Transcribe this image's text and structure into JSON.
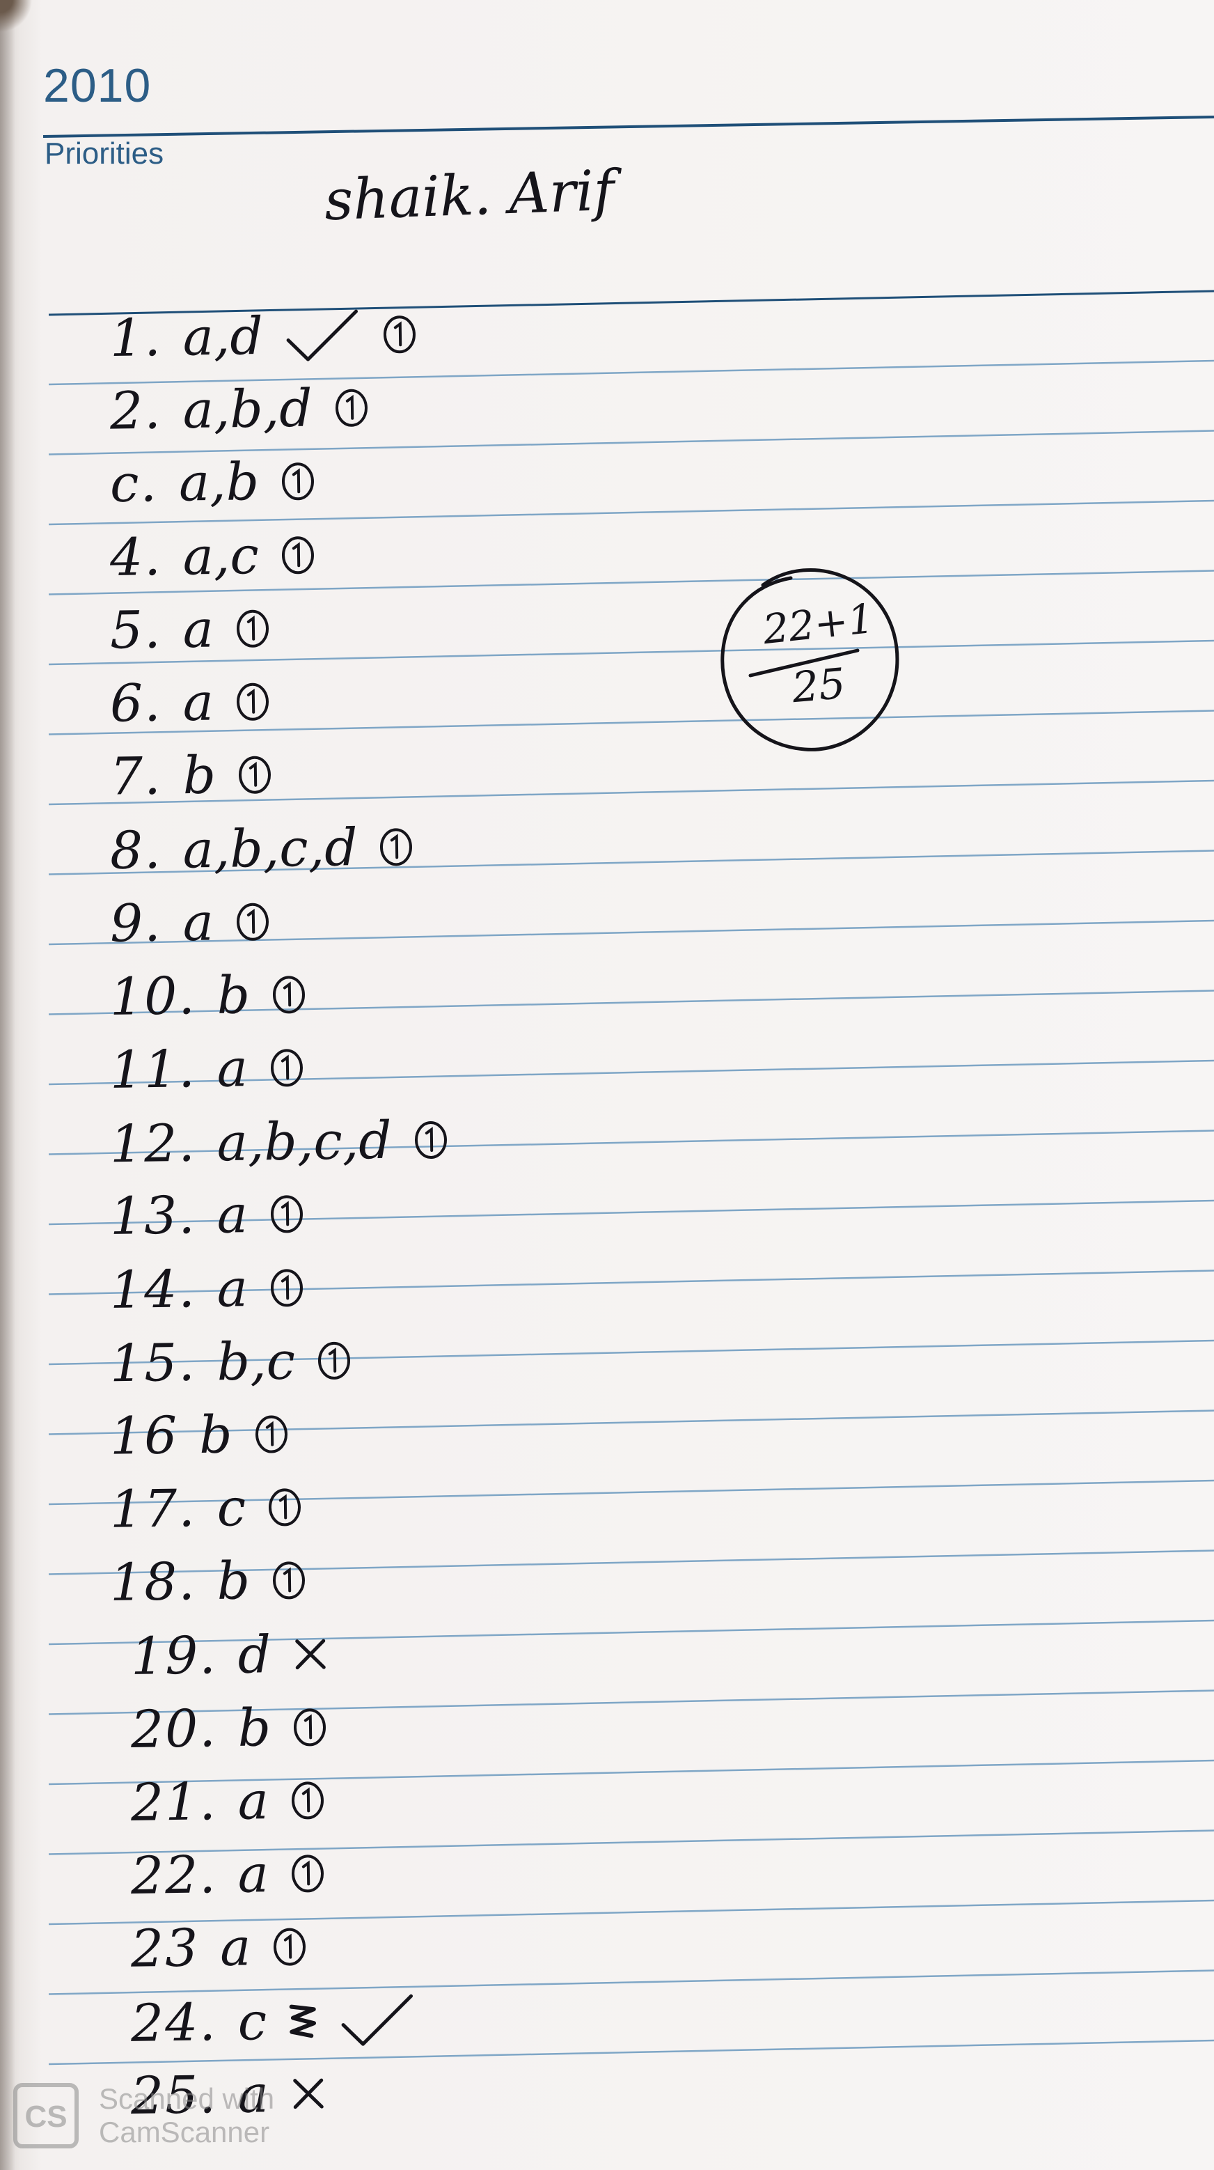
{
  "header": {
    "year": "2010",
    "section_label": "Priorities"
  },
  "student_name": "shaik. Arif",
  "score": {
    "numerator": "22+1",
    "denominator": "25"
  },
  "answers": [
    {
      "num": "1.",
      "answer": "a,d",
      "marks": [
        "check",
        "circle-1"
      ]
    },
    {
      "num": "2.",
      "answer": "a,b,d",
      "marks": [
        "circle-1"
      ]
    },
    {
      "num": "c.",
      "answer": "a,b",
      "marks": [
        "circle-1"
      ]
    },
    {
      "num": "4.",
      "answer": "a,c",
      "marks": [
        "circle-1"
      ]
    },
    {
      "num": "5.",
      "answer": "a",
      "marks": [
        "circle-1"
      ]
    },
    {
      "num": "6.",
      "answer": "a",
      "marks": [
        "circle-1"
      ]
    },
    {
      "num": "7.",
      "answer": "b",
      "marks": [
        "circle-1"
      ]
    },
    {
      "num": "8.",
      "answer": "a,b,c,d",
      "marks": [
        "circle-1"
      ]
    },
    {
      "num": "9.",
      "answer": "a",
      "marks": [
        "circle-1"
      ]
    },
    {
      "num": "10.",
      "answer": "b",
      "marks": [
        "circle-1"
      ]
    },
    {
      "num": "11.",
      "answer": "a",
      "marks": [
        "circle-1"
      ]
    },
    {
      "num": "12.",
      "answer": "a,b,c,d",
      "marks": [
        "circle-1"
      ]
    },
    {
      "num": "13.",
      "answer": "a",
      "marks": [
        "circle-1"
      ]
    },
    {
      "num": "14.",
      "answer": "a",
      "marks": [
        "circle-1"
      ]
    },
    {
      "num": "15.",
      "answer": "b,c",
      "marks": [
        "circle-1"
      ]
    },
    {
      "num": "16",
      "answer": "b",
      "marks": [
        "circle-1"
      ]
    },
    {
      "num": "17.",
      "answer": "c",
      "marks": [
        "circle-1"
      ]
    },
    {
      "num": "18.",
      "answer": "b",
      "marks": [
        "circle-1"
      ]
    },
    {
      "num": "19.",
      "answer": "d",
      "marks": [
        "cross"
      ]
    },
    {
      "num": "20.",
      "answer": "b",
      "marks": [
        "circle-1"
      ]
    },
    {
      "num": "21.",
      "answer": "a",
      "marks": [
        "circle-1"
      ]
    },
    {
      "num": "22.",
      "answer": "a",
      "marks": [
        "circle-1"
      ]
    },
    {
      "num": "23",
      "answer": "a",
      "marks": [
        "circle-1"
      ]
    },
    {
      "num": "24.",
      "answer": "c",
      "marks": [
        "scribble",
        "check"
      ]
    },
    {
      "num": "25.",
      "answer": "a",
      "marks": [
        "cross"
      ]
    }
  ],
  "watermark": {
    "logo_text": "CS",
    "line1": "Scanned with",
    "line2": "CamScanner"
  },
  "colors": {
    "ink": "#15141a",
    "printed_blue": "#2c5d86",
    "rule_dark": "#1f4f78",
    "rule_light": "#7fa6c6"
  }
}
